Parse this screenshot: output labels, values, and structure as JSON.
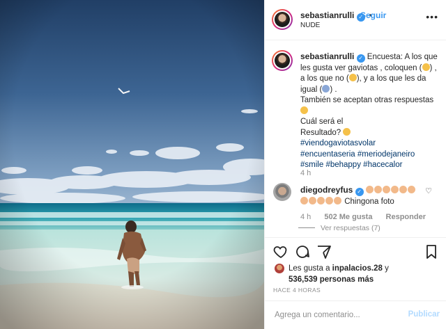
{
  "post": {
    "username": "sebastianrulli",
    "follow_label": "Seguir",
    "follow_separator": "•",
    "location": "NUDE",
    "more_icon": "more-icon"
  },
  "caption": {
    "username": "sebastianrulli",
    "line1": "Encuesta: A los que les gusta ver gaviotas , coloquen (",
    "line1b": ") , a los que no (",
    "line1c": "), y a los que les da igual (",
    "line1d": ") .",
    "line2": "También se aceptan otras respuestas",
    "line3": "Cuál será el",
    "line4": "Resultado?",
    "hashtags_1": "#viendogaviotasvolar",
    "hashtags_2": "#encuentaseria",
    "hashtags_3": "#meriodejaneiro",
    "hashtags_4": "#smile",
    "hashtags_5": "#behappy",
    "hashtags_6": "#hacecalor",
    "time": "4 h"
  },
  "comment": {
    "username": "diegodreyfus",
    "text": "Chingona foto",
    "time": "4 h",
    "likes": "502 Me gusta",
    "reply_label": "Responder",
    "view_replies": "Ver respuestas (7)"
  },
  "likes": {
    "prefix": "Les gusta a",
    "user": "inpalacios.28",
    "connector": "y",
    "count": "536,539 personas más"
  },
  "timestamp": "HACE 4 HORAS",
  "add_comment": {
    "placeholder": "Agrega un comentario...",
    "publish_label": "Publicar"
  },
  "colors": {
    "accent": "#3897f0",
    "hashtag": "#003569",
    "muted": "#8e8e8e",
    "publish_disabled": "#b3dbff"
  }
}
